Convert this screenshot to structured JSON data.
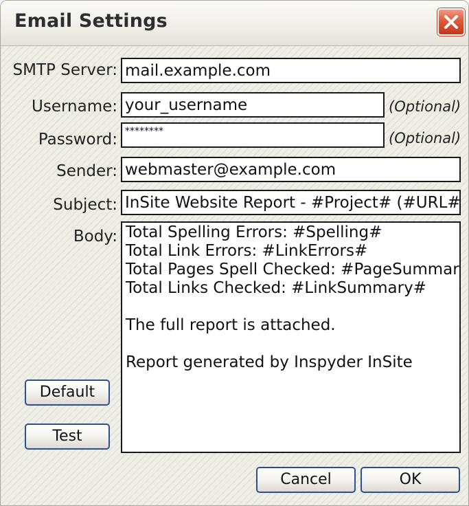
{
  "window": {
    "title": "Email Settings"
  },
  "form": {
    "smtp_label": "SMTP Server:",
    "smtp_value": "mail.example.com",
    "username_label": "Username:",
    "username_value": "your_username",
    "username_hint": "(Optional)",
    "password_label": "Password:",
    "password_value": "********",
    "password_hint": "(Optional)",
    "sender_label": "Sender:",
    "sender_value": "webmaster@example.com",
    "subject_label": "Subject:",
    "subject_value": "InSite Website Report - #Project# (#URL#)",
    "body_label": "Body:",
    "body_lines": [
      "Total Spelling Errors: #Spelling#",
      "Total Link Errors: #LinkErrors#",
      "Total Pages Spell Checked: #PageSummary#",
      "Total Links Checked: #LinkSummary#",
      "",
      "The full report is attached.",
      "",
      "Report generated by Inspyder InSite"
    ]
  },
  "buttons": {
    "default_label": "Default",
    "test_label": "Test",
    "cancel_label": "Cancel",
    "ok_label": "OK"
  },
  "icons": {
    "close": "close-icon"
  },
  "colors": {
    "close_button": "#df5a3c",
    "button_border": "#2b4f8f"
  }
}
